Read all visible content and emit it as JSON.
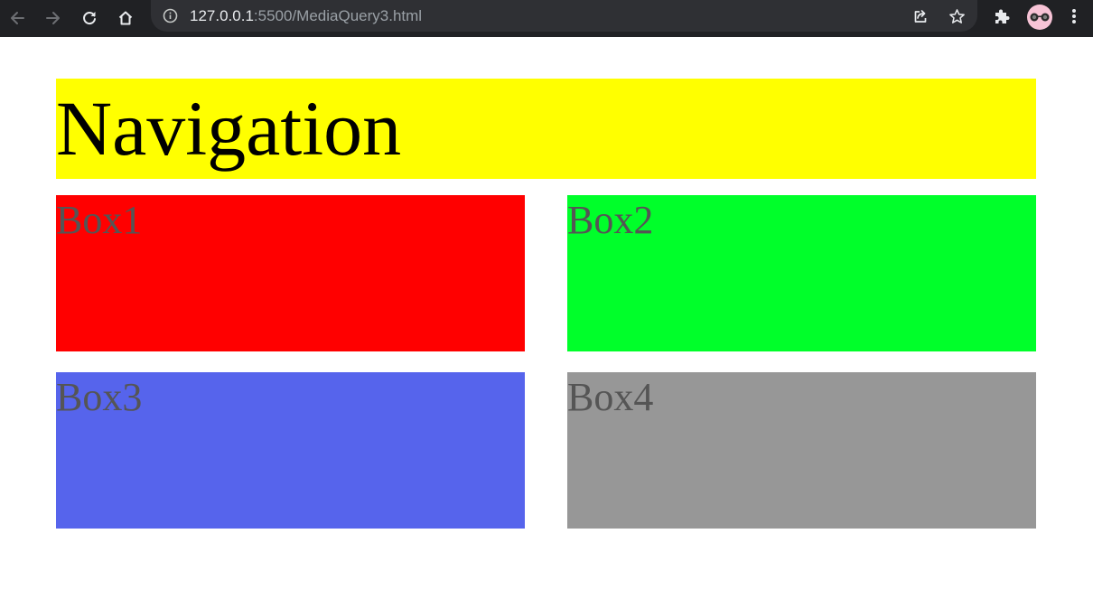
{
  "browser": {
    "url_host": "127.0.0.1",
    "url_path": ":5500/MediaQuery3.html",
    "icons": {
      "back": "arrow-left-icon",
      "forward": "arrow-right-icon",
      "reload": "reload-icon",
      "home": "home-icon",
      "site_info": "info-icon",
      "share": "share-icon",
      "bookmark": "star-icon",
      "extensions": "puzzle-icon",
      "profile": "avatar",
      "menu": "kebab-menu-icon"
    },
    "colors": {
      "toolbar": "#202124",
      "omnibox": "#2f3034"
    }
  },
  "page": {
    "navigation": {
      "text": "Navigation",
      "color": "#ffff00"
    },
    "boxes": [
      {
        "label": "Box1",
        "color": "#ff0000"
      },
      {
        "label": "Box2",
        "color": "#00ff2a"
      },
      {
        "label": "Box3",
        "color": "#5664ec"
      },
      {
        "label": "Box4",
        "color": "#979797"
      }
    ]
  }
}
